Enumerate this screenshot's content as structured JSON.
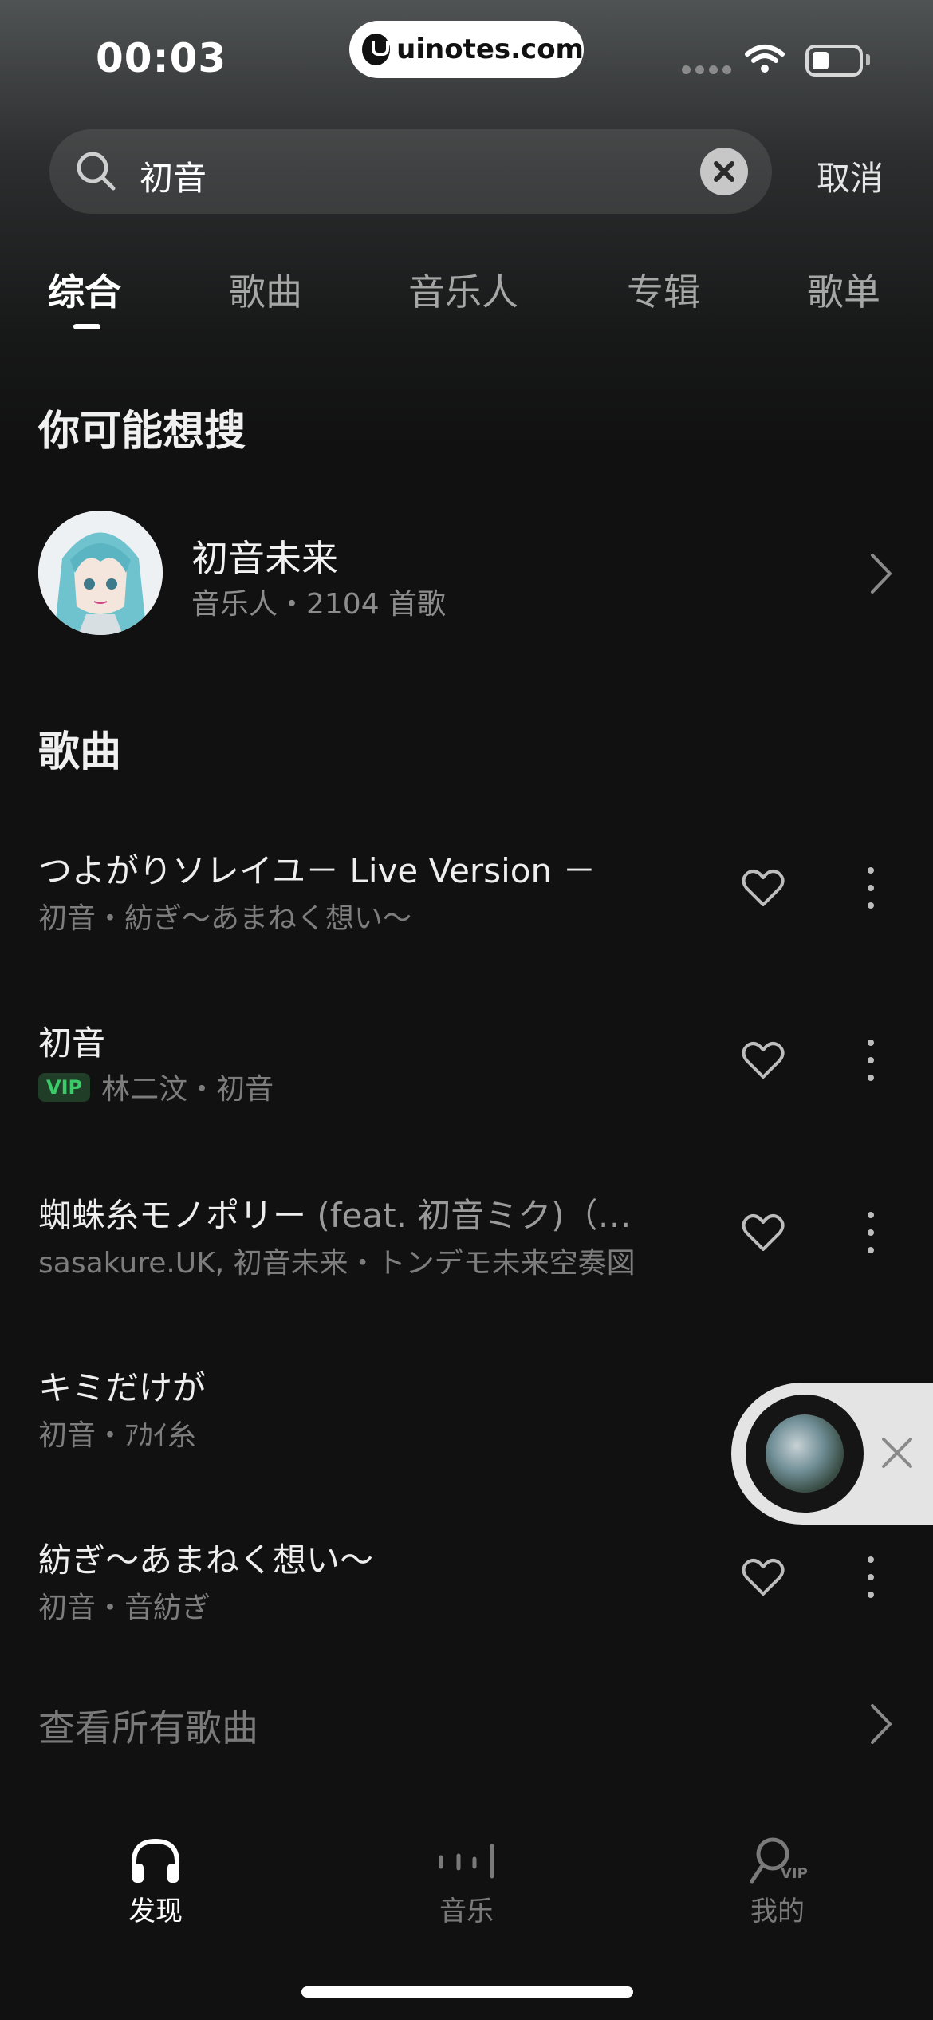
{
  "status_bar": {
    "time": "00:03",
    "watermark": "uinotes.com"
  },
  "search": {
    "query": "初音",
    "cancel_label": "取消"
  },
  "tabs": [
    {
      "label": "综合",
      "active": true
    },
    {
      "label": "歌曲",
      "active": false
    },
    {
      "label": "音乐人",
      "active": false
    },
    {
      "label": "专辑",
      "active": false
    },
    {
      "label": "歌单",
      "active": false
    }
  ],
  "suggest": {
    "title": "你可能想搜",
    "artist": {
      "name": "初音未来",
      "subtitle": "音乐人・2104 首歌"
    }
  },
  "songs_section": {
    "title": "歌曲",
    "items": [
      {
        "title": "つよがりソレイユ－ Live Version －",
        "title_extra": "",
        "subtitle": "初音・紡ぎ～あまねく想い～",
        "vip": false
      },
      {
        "title": "初音",
        "title_extra": "",
        "subtitle": "林二汶・初音",
        "vip": true,
        "vip_label": "VIP"
      },
      {
        "title": "蜘蛛糸モノポリー",
        "title_extra": " (feat. 初音ミク)（…",
        "subtitle": "sasakure.UK, 初音未来・トンデモ未来空奏図",
        "vip": false
      },
      {
        "title": "キミだけが",
        "title_extra": "",
        "subtitle": "初音・ｱｶｲ糸",
        "vip": false
      },
      {
        "title": "紡ぎ～あまねく想い～",
        "title_extra": "",
        "subtitle": "初音・音紡ぎ",
        "vip": false
      }
    ],
    "see_all_label": "查看所有歌曲"
  },
  "bottom_nav": [
    {
      "label": "发现",
      "icon": "headphones-icon",
      "active": true
    },
    {
      "label": "音乐",
      "icon": "equalizer-icon",
      "active": false
    },
    {
      "label": "我的",
      "icon": "profile-vip-icon",
      "active": false
    }
  ],
  "colors": {
    "background": "#111111",
    "vip_green": "#3ccb69",
    "text_primary": "#eeeeee",
    "text_secondary": "#7d7d7d"
  }
}
